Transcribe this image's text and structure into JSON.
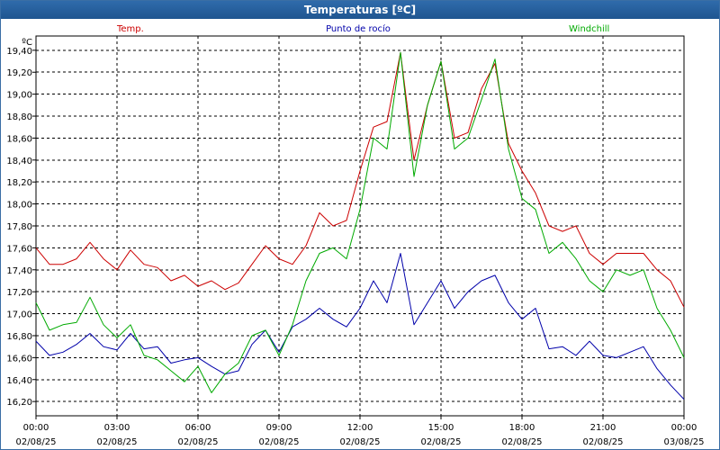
{
  "window_title": "Temperaturas [ºC]",
  "chart_data": {
    "type": "line",
    "title": "Temperaturas [ºC]",
    "ylabel": "ºC",
    "xlabel": "",
    "ylim": [
      16.07,
      19.53
    ],
    "xlim": [
      0,
      24
    ],
    "grid": true,
    "legend_position": "top",
    "y_ticks": [
      "16,20",
      "16,40",
      "16,60",
      "16,80",
      "17,00",
      "17,20",
      "17,40",
      "17,60",
      "17,80",
      "18,00",
      "18,20",
      "18,40",
      "18,60",
      "18,80",
      "19,00",
      "19,20",
      "19,40"
    ],
    "x_ticks": [
      {
        "time": "00:00",
        "date": "02/08/25"
      },
      {
        "time": "03:00",
        "date": "02/08/25"
      },
      {
        "time": "06:00",
        "date": "02/08/25"
      },
      {
        "time": "09:00",
        "date": "02/08/25"
      },
      {
        "time": "12:00",
        "date": "02/08/25"
      },
      {
        "time": "15:00",
        "date": "02/08/25"
      },
      {
        "time": "18:00",
        "date": "02/08/25"
      },
      {
        "time": "21:00",
        "date": "02/08/25"
      },
      {
        "time": "00:00",
        "date": "03/08/25"
      }
    ],
    "x": [
      0,
      0.5,
      1,
      1.5,
      2,
      2.5,
      3,
      3.5,
      4,
      4.5,
      5,
      5.5,
      6,
      6.5,
      7,
      7.5,
      8,
      8.5,
      9,
      9.5,
      10,
      10.5,
      11,
      11.5,
      12,
      12.5,
      13,
      13.5,
      14,
      14.5,
      15,
      15.5,
      16,
      16.5,
      17,
      17.5,
      18,
      18.5,
      19,
      19.5,
      20,
      20.5,
      21,
      21.5,
      22,
      22.5,
      23,
      23.5,
      24
    ],
    "series": [
      {
        "name": "Temp.",
        "color": "#cc0000",
        "values": [
          17.6,
          17.45,
          17.45,
          17.5,
          17.65,
          17.5,
          17.4,
          17.58,
          17.45,
          17.42,
          17.3,
          17.35,
          17.25,
          17.3,
          17.22,
          17.28,
          17.45,
          17.62,
          17.5,
          17.45,
          17.62,
          17.92,
          17.8,
          17.85,
          18.3,
          18.7,
          18.75,
          19.38,
          18.4,
          18.9,
          19.3,
          18.6,
          18.65,
          19.05,
          19.28,
          18.55,
          18.3,
          18.1,
          17.8,
          17.75,
          17.8,
          17.55,
          17.45,
          17.55,
          17.55,
          17.55,
          17.4,
          17.3,
          17.06
        ]
      },
      {
        "name": "Punto de rocío",
        "color": "#0000aa",
        "values": [
          16.75,
          16.62,
          16.65,
          16.72,
          16.82,
          16.7,
          16.67,
          16.82,
          16.68,
          16.7,
          16.55,
          16.58,
          16.6,
          16.52,
          16.45,
          16.48,
          16.72,
          16.85,
          16.65,
          16.88,
          16.95,
          17.05,
          16.95,
          16.88,
          17.05,
          17.3,
          17.1,
          17.55,
          16.9,
          17.1,
          17.3,
          17.05,
          17.2,
          17.3,
          17.35,
          17.1,
          16.95,
          17.05,
          16.68,
          16.7,
          16.62,
          16.75,
          16.62,
          16.6,
          16.65,
          16.7,
          16.5,
          16.35,
          16.22
        ]
      },
      {
        "name": "Windchill",
        "color": "#00aa00",
        "values": [
          17.1,
          16.85,
          16.9,
          16.92,
          17.15,
          16.9,
          16.78,
          16.9,
          16.62,
          16.58,
          16.48,
          16.38,
          16.52,
          16.28,
          16.45,
          16.55,
          16.8,
          16.85,
          16.62,
          16.9,
          17.3,
          17.55,
          17.6,
          17.5,
          17.95,
          18.6,
          18.5,
          19.38,
          18.25,
          18.9,
          19.3,
          18.5,
          18.6,
          18.95,
          19.32,
          18.5,
          18.05,
          17.95,
          17.55,
          17.65,
          17.5,
          17.3,
          17.2,
          17.4,
          17.35,
          17.4,
          17.05,
          16.85,
          16.6
        ]
      }
    ]
  }
}
